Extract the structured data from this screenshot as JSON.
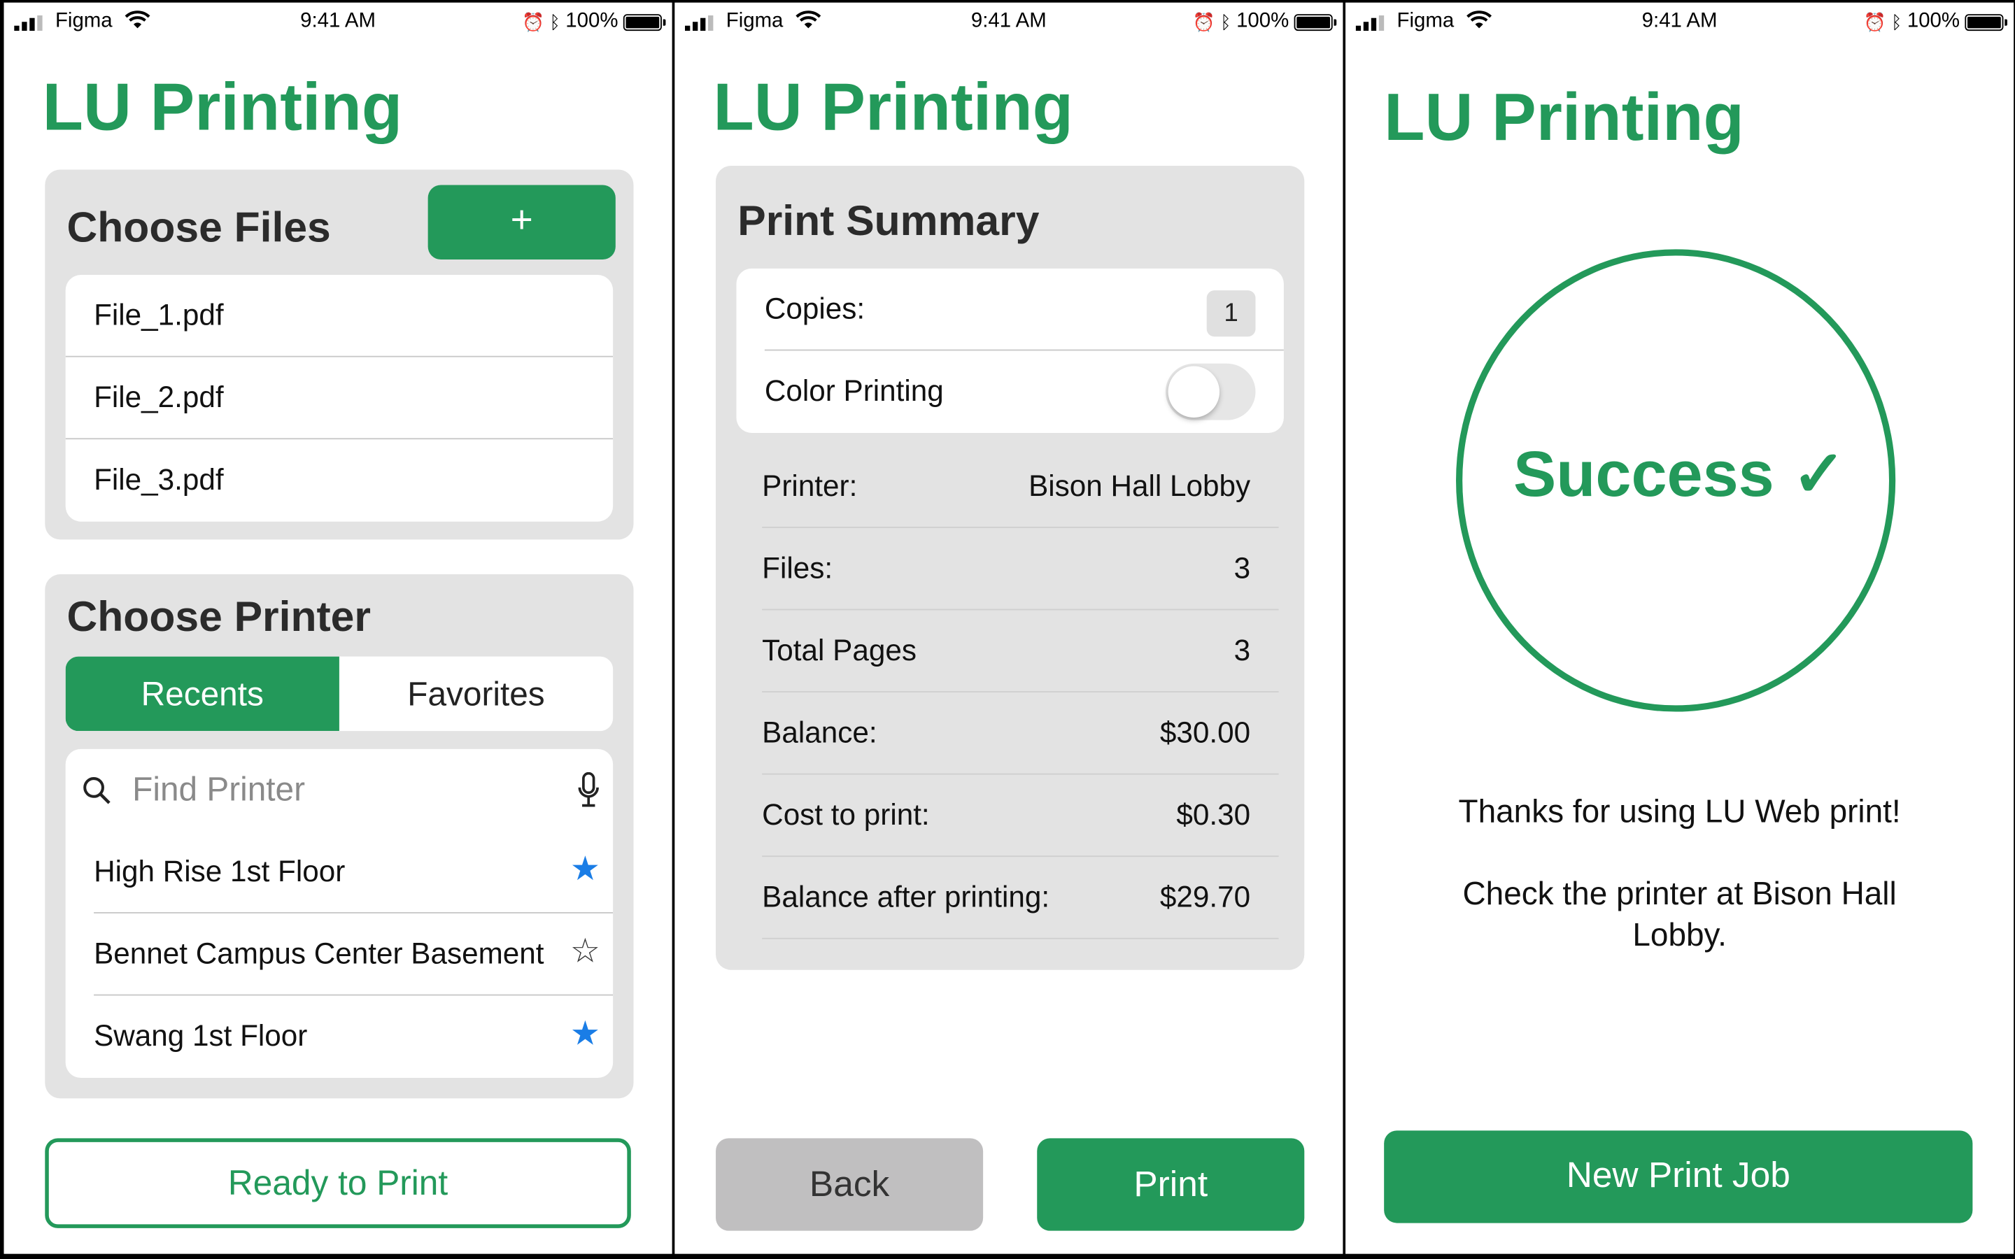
{
  "status_bar": {
    "carrier": "Figma",
    "time": "9:41 AM",
    "battery": "100%"
  },
  "screens": [
    {
      "app_title": "LU Printing",
      "files": {
        "heading": "Choose Files",
        "add_label": "+",
        "items": [
          "File_1.pdf",
          "File_2.pdf",
          "File_3.pdf"
        ]
      },
      "printers": {
        "heading": "Choose Printer",
        "tabs": [
          {
            "label": "Recents",
            "selected": true
          },
          {
            "label": "Favorites",
            "selected": false
          }
        ],
        "search_placeholder": "Find Printer",
        "items": [
          {
            "name": "High Rise 1st Floor",
            "favorite": true,
            "star": "★"
          },
          {
            "name": "Bennet Campus Center Basement",
            "favorite": false,
            "star": "☆"
          },
          {
            "name": "Swang 1st Floor",
            "favorite": true,
            "star": "★"
          }
        ]
      },
      "ready_button": "Ready to Print"
    },
    {
      "app_title": "LU Printing",
      "summary": {
        "heading": "Print Summary",
        "copies_label": "Copies:",
        "copies_value": "1",
        "color_label": "Color Printing",
        "color_enabled": false,
        "rows": [
          {
            "label": "Printer:",
            "value": "Bison Hall Lobby"
          },
          {
            "label": "Files:",
            "value": "3"
          },
          {
            "label": "Total Pages",
            "value": "3"
          },
          {
            "label": "Balance:",
            "value": "$30.00"
          },
          {
            "label": "Cost to print:",
            "value": "$0.30"
          },
          {
            "label": "Balance after printing:",
            "value": "$29.70"
          }
        ]
      },
      "back_button": "Back",
      "print_button": "Print"
    },
    {
      "app_title": "LU Printing",
      "success_text": "Success ✓",
      "thanks": "Thanks for using LU Web print!",
      "check_line1": "Check the printer at Bison Hall",
      "check_line2": "Lobby.",
      "new_job_button": "New Print Job"
    }
  ],
  "colors": {
    "brand_green": "#23995a",
    "card_gray": "#e3e3e3",
    "star_blue": "#1a7de6",
    "back_gray": "#c0bfc0"
  },
  "icons": [
    "signal-icon",
    "wifi-icon",
    "alarm-icon",
    "bluetooth-icon",
    "battery-icon",
    "search-icon",
    "microphone-icon",
    "star-icon",
    "checkmark-icon"
  ]
}
